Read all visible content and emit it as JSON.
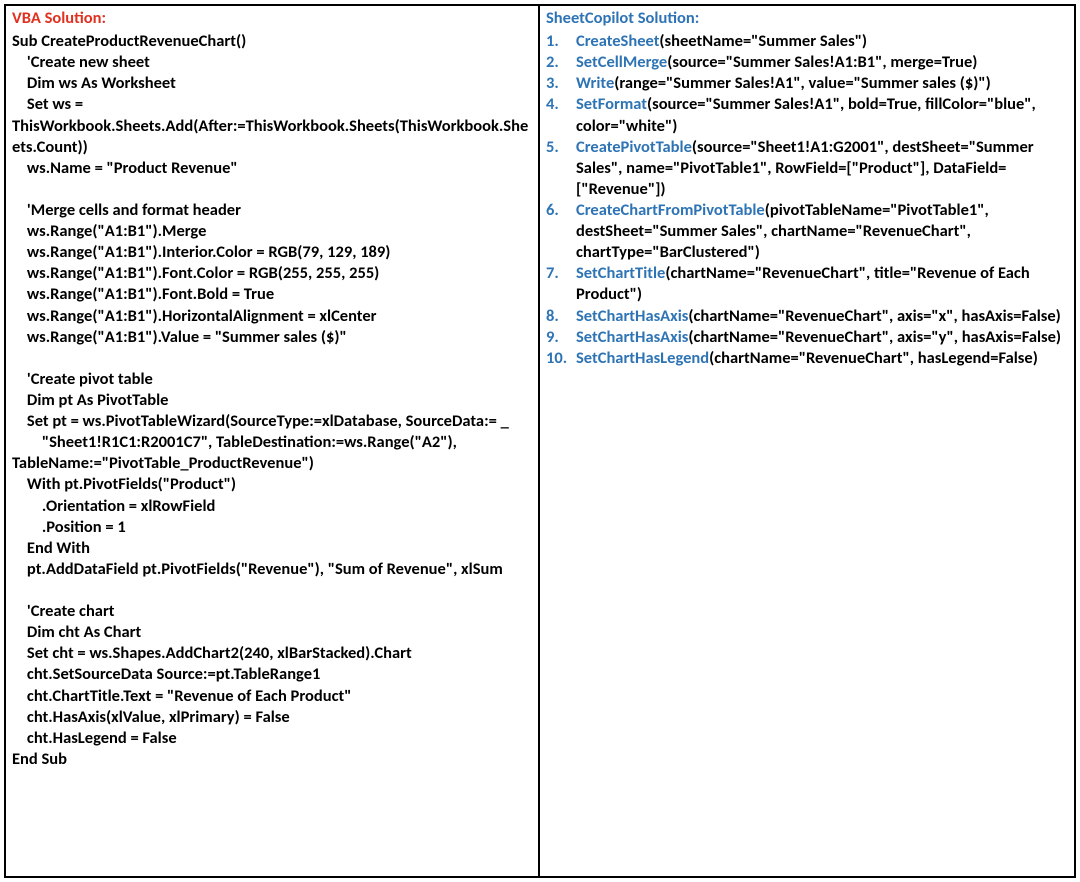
{
  "left": {
    "title": "VBA Solution:",
    "code": "Sub CreateProductRevenueChart()\n    'Create new sheet\n    Dim ws As Worksheet\n    Set ws =\nThisWorkbook.Sheets.Add(After:=ThisWorkbook.Sheets(ThisWorkbook.Sheets.Count))\n    ws.Name = \"Product Revenue\"\n\n    'Merge cells and format header\n    ws.Range(\"A1:B1\").Merge\n    ws.Range(\"A1:B1\").Interior.Color = RGB(79, 129, 189)\n    ws.Range(\"A1:B1\").Font.Color = RGB(255, 255, 255)\n    ws.Range(\"A1:B1\").Font.Bold = True\n    ws.Range(\"A1:B1\").HorizontalAlignment = xlCenter\n    ws.Range(\"A1:B1\").Value = \"Summer sales ($)\"\n\n    'Create pivot table\n    Dim pt As PivotTable\n    Set pt = ws.PivotTableWizard(SourceType:=xlDatabase, SourceData:= _\n        \"Sheet1!R1C1:R2001C7\", TableDestination:=ws.Range(\"A2\"), TableName:=\"PivotTable_ProductRevenue\")\n    With pt.PivotFields(\"Product\")\n        .Orientation = xlRowField\n        .Position = 1\n    End With\n    pt.AddDataField pt.PivotFields(\"Revenue\"), \"Sum of Revenue\", xlSum\n\n    'Create chart\n    Dim cht As Chart\n    Set cht = ws.Shapes.AddChart2(240, xlBarStacked).Chart\n    cht.SetSourceData Source:=pt.TableRange1\n    cht.ChartTitle.Text = \"Revenue of Each Product\"\n    cht.HasAxis(xlValue, xlPrimary) = False\n    cht.HasLegend = False\nEnd Sub"
  },
  "right": {
    "title": "SheetCopilot Solution:",
    "steps": [
      {
        "fn": "CreateSheet",
        "args": "(sheetName=\"Summer Sales\")"
      },
      {
        "fn": "SetCellMerge",
        "args": "(source=\"Summer Sales!A1:B1\", merge=True)"
      },
      {
        "fn": "Write",
        "args": "(range=\"Summer Sales!A1\", value=\"Summer sales ($)\")"
      },
      {
        "fn": "SetFormat",
        "args": "(source=\"Summer Sales!A1\", bold=True, fillColor=\"blue\", color=\"white\")"
      },
      {
        "fn": "CreatePivotTable",
        "args": "(source=\"Sheet1!A1:G2001\", destSheet=\"Summer Sales\", name=\"PivotTable1\", RowField=[\"Product\"], DataField=[\"Revenue\"])"
      },
      {
        "fn": "CreateChartFromPivotTable",
        "args": "(pivotTableName=\"PivotTable1\", destSheet=\"Summer Sales\", chartName=\"RevenueChart\", chartType=\"BarClustered\")"
      },
      {
        "fn": "SetChartTitle",
        "args": "(chartName=\"RevenueChart\", title=\"Revenue of Each Product\")"
      },
      {
        "fn": "SetChartHasAxis",
        "args": "(chartName=\"RevenueChart\", axis=\"x\", hasAxis=False)"
      },
      {
        "fn": "SetChartHasAxis",
        "args": "(chartName=\"RevenueChart\", axis=\"y\", hasAxis=False)"
      },
      {
        "fn": "SetChartHasLegend",
        "args": "(chartName=\"RevenueChart\", hasLegend=False)"
      }
    ]
  }
}
